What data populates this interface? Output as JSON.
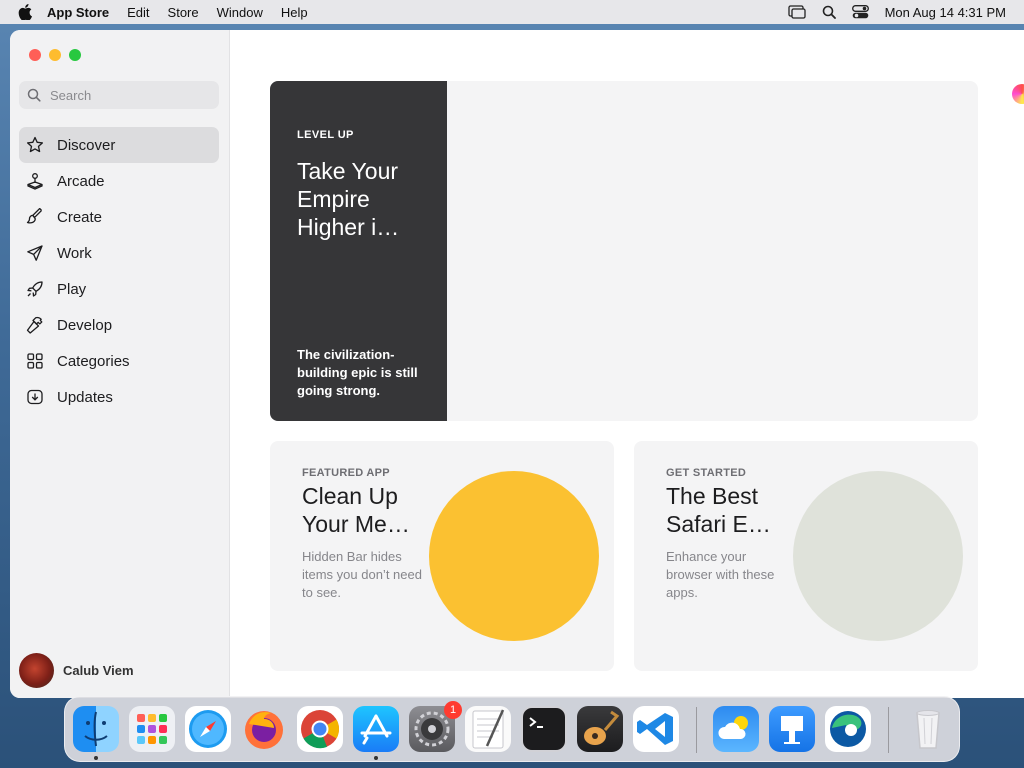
{
  "menubar": {
    "app_name": "App Store",
    "menus": [
      "Edit",
      "Store",
      "Window",
      "Help"
    ],
    "status_icons": [
      "screen-mirroring-icon",
      "spotlight-search-icon",
      "control-center-icon"
    ],
    "clock": "Mon Aug 14  4:31 PM"
  },
  "sidebar": {
    "search_placeholder": "Search",
    "items": [
      {
        "label": "Discover",
        "icon": "star-icon",
        "active": true
      },
      {
        "label": "Arcade",
        "icon": "joystick-icon"
      },
      {
        "label": "Create",
        "icon": "paintbrush-icon"
      },
      {
        "label": "Work",
        "icon": "paper-plane-icon"
      },
      {
        "label": "Play",
        "icon": "rocket-icon"
      },
      {
        "label": "Develop",
        "icon": "hammer-icon"
      },
      {
        "label": "Categories",
        "icon": "grid-icon"
      },
      {
        "label": "Updates",
        "icon": "download-icon"
      }
    ],
    "user_name": "Calub Viem"
  },
  "main": {
    "hero": {
      "eyebrow": "LEVEL UP",
      "title": "Take Your Empire Higher i…",
      "description": "The civilization-building epic is still going strong."
    },
    "cards": [
      {
        "eyebrow": "FEATURED APP",
        "title": "Clean Up Your Me…",
        "description": "Hidden Bar hides items you don’t need to see.",
        "color": "#fbc131"
      },
      {
        "eyebrow": "GET STARTED",
        "title": "The Best Safari E…",
        "description": "Enhance your browser with these apps.",
        "color": "#dfe2da"
      }
    ]
  },
  "dock": {
    "apps": [
      "Finder",
      "Launchpad",
      "Safari",
      "Firefox",
      "Chrome",
      "App Store",
      "System Settings",
      "TextEdit",
      "Terminal",
      "GarageBand",
      "Visual Studio Code",
      "Weather",
      "Keynote",
      "Microsoft Edge",
      "Trash"
    ],
    "settings_badge": "1"
  }
}
